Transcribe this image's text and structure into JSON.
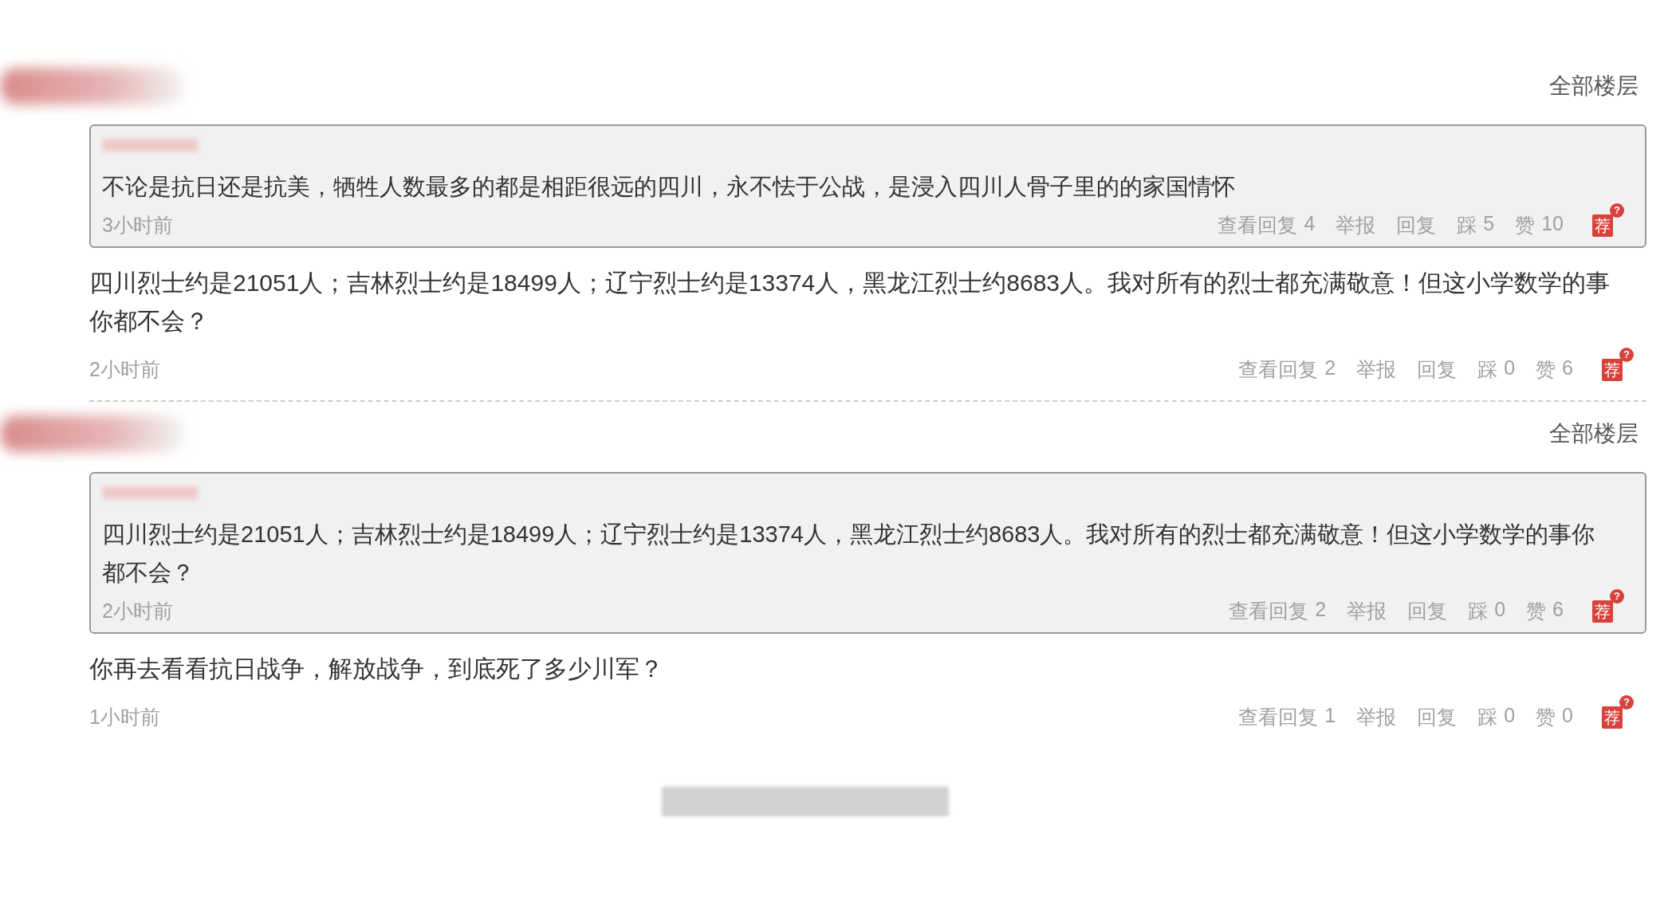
{
  "threads": [
    {
      "floors_link": "全部楼层",
      "quote": {
        "text": "不论是抗日还是抗美，牺牲人数最多的都是相距很远的四川，永不怯于公战，是浸入四川人骨子里的的家国情怀",
        "time": "3小时前",
        "actions": [
          {
            "label": "查看回复",
            "count": "4"
          },
          {
            "label": "举报"
          },
          {
            "label": "回复"
          },
          {
            "label": "踩",
            "count": "5"
          },
          {
            "label": "赞",
            "count": "10"
          }
        ],
        "badge": "荐",
        "badge_help": "?"
      },
      "reply": {
        "text": "四川烈士约是21051人；吉林烈士约是18499人；辽宁烈士约是13374人，黑龙江烈士约8683人。我对所有的烈士都充满敬意！但这小学数学的事你都不会？",
        "time": "2小时前",
        "actions": [
          {
            "label": "查看回复",
            "count": "2"
          },
          {
            "label": "举报"
          },
          {
            "label": "回复"
          },
          {
            "label": "踩",
            "count": "0"
          },
          {
            "label": "赞",
            "count": "6"
          }
        ],
        "badge": "荐",
        "badge_help": "?"
      }
    },
    {
      "floors_link": "全部楼层",
      "quote": {
        "text": "四川烈士约是21051人；吉林烈士约是18499人；辽宁烈士约是13374人，黑龙江烈士约8683人。我对所有的烈士都充满敬意！但这小学数学的事你都不会？",
        "time": "2小时前",
        "actions": [
          {
            "label": "查看回复",
            "count": "2"
          },
          {
            "label": "举报"
          },
          {
            "label": "回复"
          },
          {
            "label": "踩",
            "count": "0"
          },
          {
            "label": "赞",
            "count": "6"
          }
        ],
        "badge": "荐",
        "badge_help": "?"
      },
      "reply": {
        "text": "你再去看看抗日战争，解放战争，到底死了多少川军？",
        "time": "1小时前",
        "actions": [
          {
            "label": "查看回复",
            "count": "1"
          },
          {
            "label": "举报"
          },
          {
            "label": "回复"
          },
          {
            "label": "踩",
            "count": "0"
          },
          {
            "label": "赞",
            "count": "0"
          }
        ],
        "badge": "荐",
        "badge_help": "?"
      }
    }
  ]
}
